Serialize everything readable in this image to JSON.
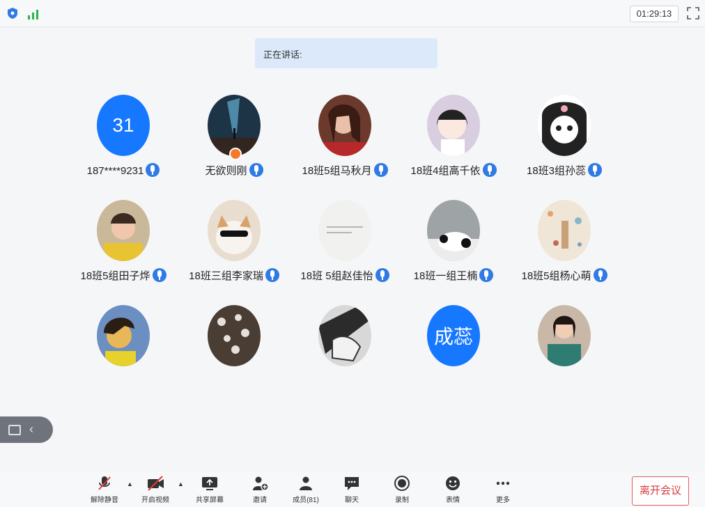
{
  "topbar": {
    "timer": "01:29:13"
  },
  "speaking": {
    "label": "正在讲话:"
  },
  "participants": [
    {
      "name": "187****9231",
      "initials": "31"
    },
    {
      "name": "无欲则刚"
    },
    {
      "name": "18班5组马秋月"
    },
    {
      "name": "18班4组高千依"
    },
    {
      "name": "18班3组孙蕊"
    },
    {
      "name": "18班5组田子烨"
    },
    {
      "name": "18班三组李家瑞"
    },
    {
      "name": "18班 5组赵佳怡"
    },
    {
      "name": "18班一组王楠"
    },
    {
      "name": "18班5组杨心萌"
    },
    {
      "name": ""
    },
    {
      "name": ""
    },
    {
      "name": ""
    },
    {
      "name": "",
      "initials": "成蕊"
    },
    {
      "name": ""
    }
  ],
  "toolbar": {
    "unmute": "解除静音",
    "start_video": "开启视频",
    "share_screen": "共享屏幕",
    "invite": "邀请",
    "members": "成员(81)",
    "chat": "聊天",
    "record": "录制",
    "reactions": "表情",
    "more": "更多",
    "leave": "离开会议"
  },
  "colors": {
    "accent": "#1677ff",
    "leave": "#d93b3b",
    "mic": "#2f7ae5"
  }
}
